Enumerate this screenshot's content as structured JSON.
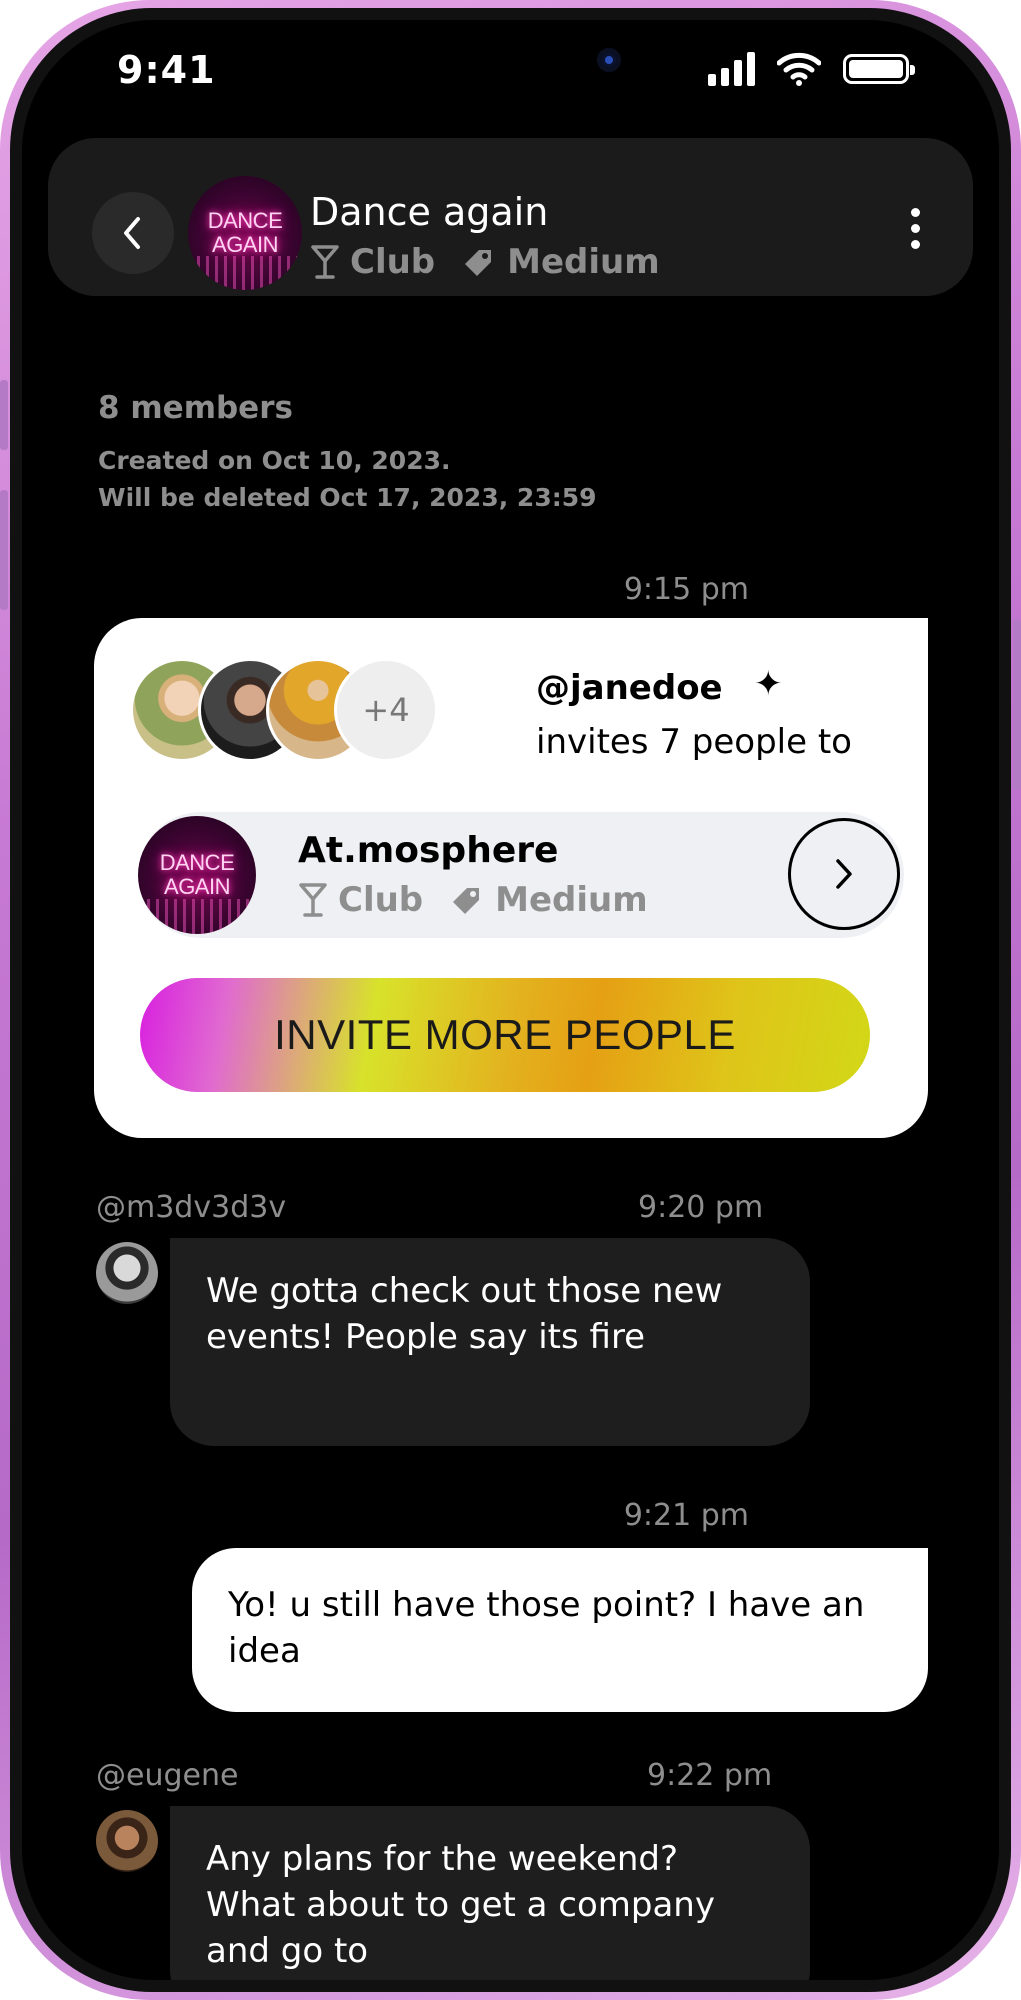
{
  "status_bar": {
    "time": "9:41"
  },
  "header": {
    "title": "Dance again",
    "avatar_text": [
      "DANCE",
      "AGAIN"
    ],
    "tags": [
      {
        "icon": "cocktail-icon",
        "label": "Club"
      },
      {
        "icon": "tag-icon",
        "label": "Medium"
      }
    ]
  },
  "chat_info": {
    "members": "8 members",
    "created": "Created on Oct 10, 2023.",
    "deletion": "Will be deleted Oct 17, 2023, 23:59"
  },
  "invite_message": {
    "time": "9:15 pm",
    "inviter": "@janedoe",
    "text": "invites 7 people to",
    "more_count": "+4",
    "event": {
      "name": "At.mosphere",
      "avatar_text": [
        "DANCE",
        "AGAIN"
      ],
      "tags": [
        {
          "icon": "cocktail-icon",
          "label": "Club"
        },
        {
          "icon": "tag-icon",
          "label": "Medium"
        }
      ]
    },
    "button_label": "INVITE MORE PEOPLE"
  },
  "messages": [
    {
      "direction": "in",
      "author": "@m3dv3d3v",
      "time": "9:20 pm",
      "text": "We gotta check out those new events! People say its fire"
    },
    {
      "direction": "out",
      "time": "9:21 pm",
      "text": "Yo! u still have those point? I have an idea"
    },
    {
      "direction": "in",
      "author": "@eugene",
      "time": "9:22 pm",
      "text": "Any plans for the weekend? What about to get a company and go to"
    }
  ],
  "colors": {
    "background": "#000000",
    "header": "#1b1b1b",
    "incoming_bubble": "#1e1e1e",
    "outgoing_bubble": "#ffffff",
    "muted_text": "#8e8e8e",
    "frame": "#c77ad3"
  }
}
